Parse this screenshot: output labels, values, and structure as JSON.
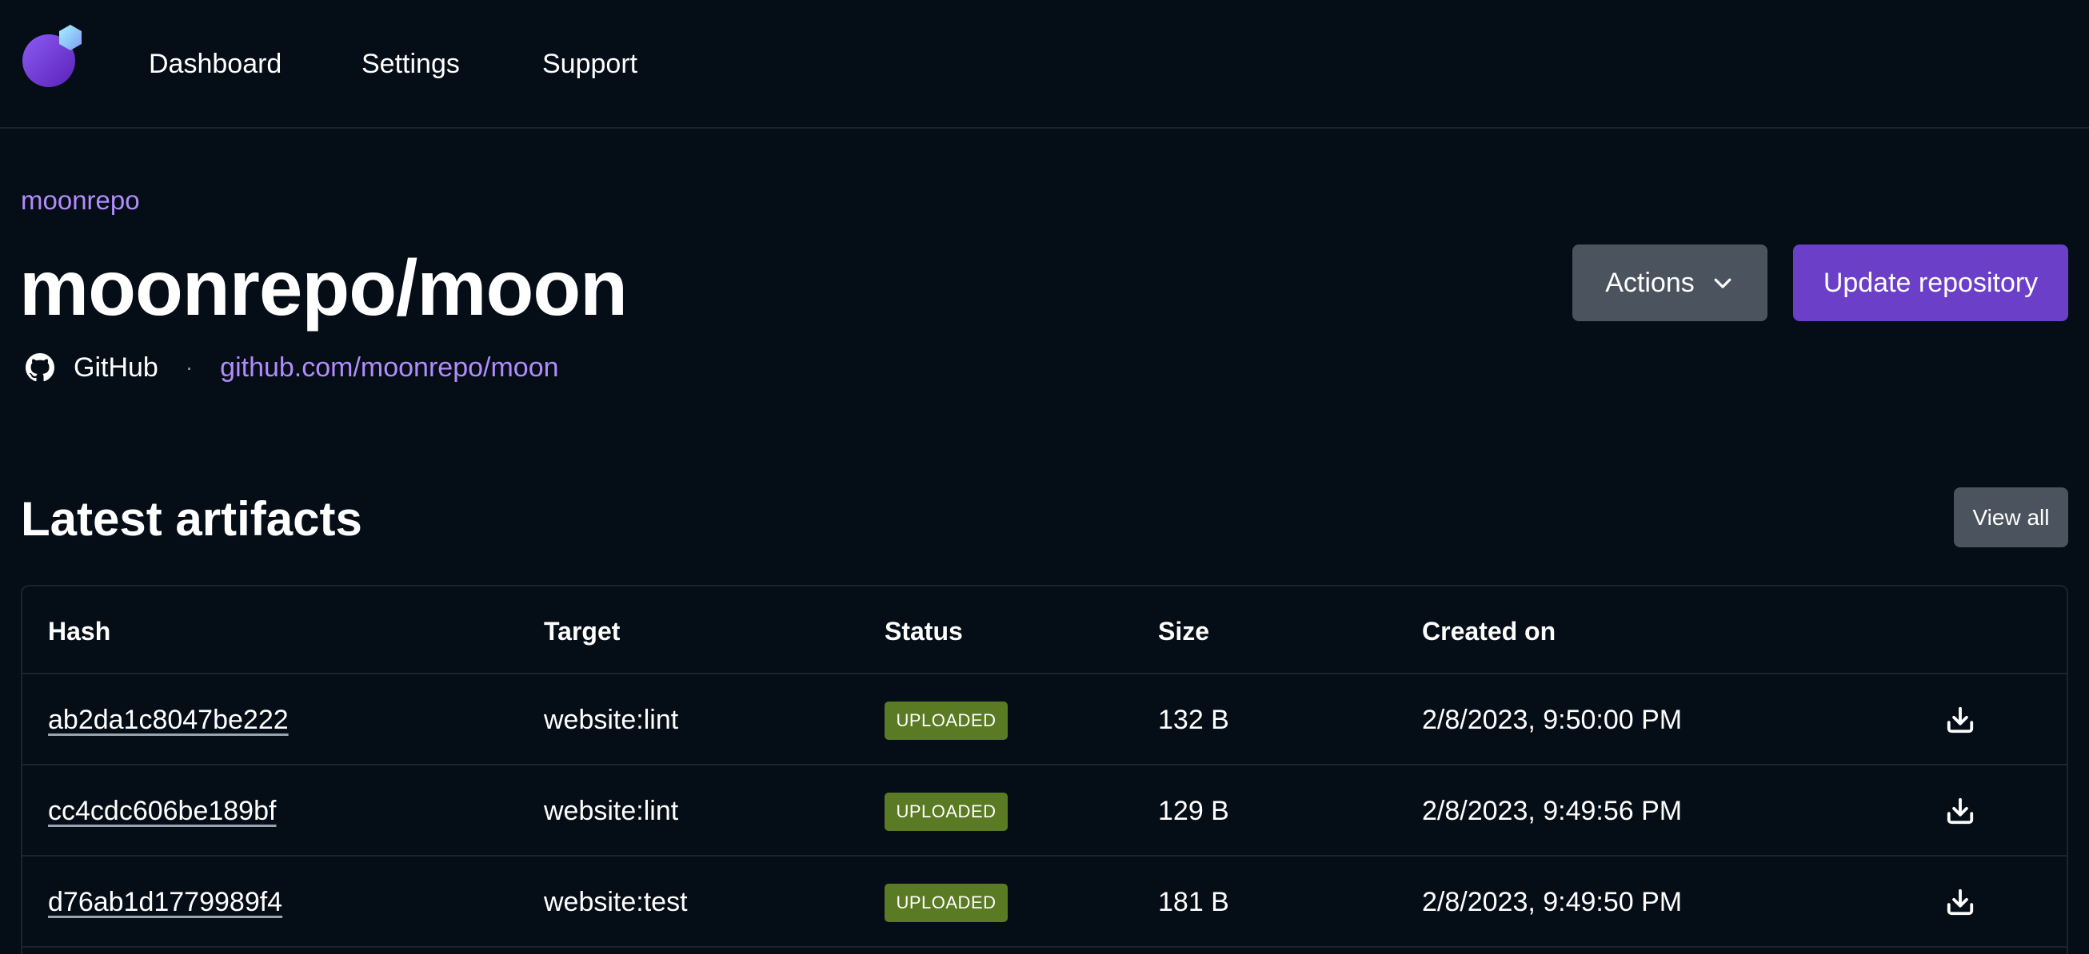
{
  "nav": {
    "items": [
      {
        "label": "Dashboard"
      },
      {
        "label": "Settings"
      },
      {
        "label": "Support"
      }
    ]
  },
  "repo": {
    "org": "moonrepo",
    "title": "moonrepo/moon",
    "provider": "GitHub",
    "separator": "·",
    "url": "github.com/moonrepo/moon",
    "provider_icon": "github-icon"
  },
  "actions": {
    "actions_label": "Actions",
    "update_label": "Update repository"
  },
  "artifacts": {
    "title": "Latest artifacts",
    "view_all_label": "View all",
    "columns": {
      "hash": "Hash",
      "target": "Target",
      "status": "Status",
      "size": "Size",
      "created": "Created on"
    },
    "rows": [
      {
        "hash": "ab2da1c8047be222",
        "target": "website:lint",
        "status": "UPLOADED",
        "size": "132 B",
        "created": "2/8/2023, 9:50:00 PM"
      },
      {
        "hash": "cc4cdc606be189bf",
        "target": "website:lint",
        "status": "UPLOADED",
        "size": "129 B",
        "created": "2/8/2023, 9:49:56 PM"
      },
      {
        "hash": "d76ab1d1779989f4",
        "target": "website:test",
        "status": "UPLOADED",
        "size": "181 B",
        "created": "2/8/2023, 9:49:50 PM"
      }
    ]
  },
  "colors": {
    "background": "#050d17",
    "accent": "#b18cfa",
    "primary_button": "#6b3fc7",
    "secondary_button": "#4b535e",
    "status_uploaded": "#5a7a23"
  }
}
